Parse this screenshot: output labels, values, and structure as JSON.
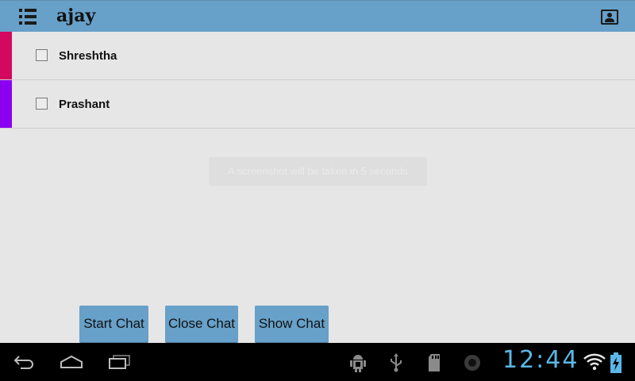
{
  "action_bar": {
    "title": "ajay",
    "menu_icon": "list-menu-icon",
    "profile_icon": "contact-card-icon",
    "background": "#67a0c8"
  },
  "contacts": [
    {
      "name": "Shreshtha",
      "color": "#d4085e",
      "checked": false
    },
    {
      "name": "Prashant",
      "color": "#8b00f0",
      "checked": false
    }
  ],
  "toast": {
    "text": "A screenshot will be taken in 5 seconds"
  },
  "buttons": {
    "start_chat": "Start Chat",
    "close_chat": "Close Chat",
    "show_chat": "Show Chat"
  },
  "system_bar": {
    "clock": "12:44",
    "clock_color": "#5bb7e6",
    "nav_icons": [
      "back-icon",
      "home-icon",
      "recent-apps-icon"
    ],
    "status_icons": [
      "android-debug-icon",
      "usb-icon",
      "sd-card-icon",
      "record-icon",
      "wifi-icon",
      "battery-charging-icon"
    ]
  }
}
